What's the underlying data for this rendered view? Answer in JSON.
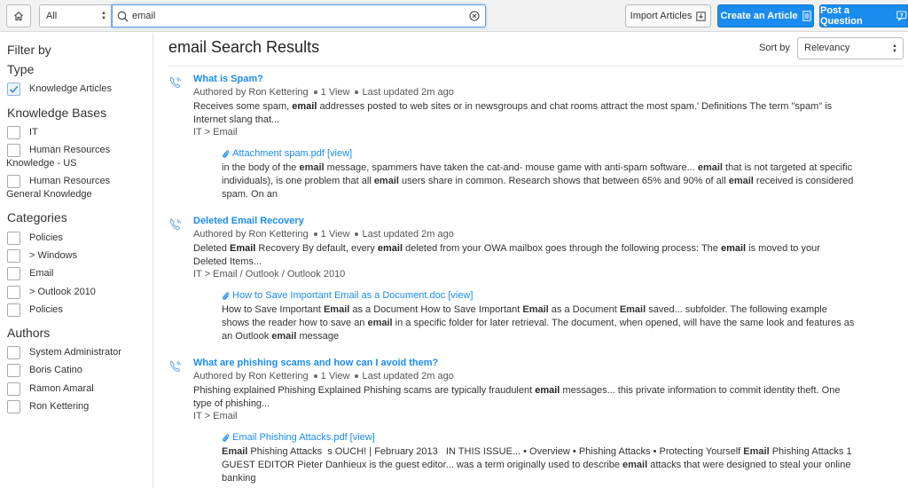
{
  "topbar": {
    "scope_value": "All",
    "search_value": "email",
    "import_label": "Import Articles",
    "create_label": "Create an Article",
    "post_label": "Post a Question"
  },
  "sidebar": {
    "filter_title": "Filter by",
    "type_title": "Type",
    "type_items": [
      {
        "label": "Knowledge Articles",
        "checked": true
      }
    ],
    "kb_title": "Knowledge Bases",
    "kb_items": [
      {
        "label": "IT"
      },
      {
        "label": "Human Resources",
        "label2": "Knowledge - US"
      },
      {
        "label": "Human Resources",
        "label2": "General Knowledge"
      }
    ],
    "categories_title": "Categories",
    "categories": [
      "Policies",
      "> Windows",
      "Email",
      "> Outlook 2010",
      "Policies"
    ],
    "authors_title": "Authors",
    "authors": [
      "System Administrator",
      "Boris Catino",
      "Ramon Amaral",
      "Ron Kettering"
    ]
  },
  "main": {
    "results_title": "email Search Results",
    "sort_label": "Sort by",
    "sort_value": "Relevancy",
    "results": [
      {
        "title": "What is Spam?",
        "author": "Authored by Ron Kettering",
        "views": "1 View",
        "updated": "Last updated 2m ago",
        "snippet_html": "Receives some spam, <b>email</b> addresses posted to web sites or in newsgroups and chat rooms attract the most spam.' Definitions The term \"spam\" is Internet slang that...",
        "path": "IT > Email",
        "attachment_title": "Attachment spam.pdf [view]",
        "attachment_snippet_html": "in the body of the <b>email</b> message, spammers have taken the cat-and- mouse game with anti-spam software... <b>email</b> that is not targeted at specific individuals), is one problem that all <b>email</b> users share in common. Research shows that between 65% and 90% of all <b>email</b> received is considered spam. On an"
      },
      {
        "title": "Deleted Email Recovery",
        "author": "Authored by Ron Kettering",
        "views": "1 View",
        "updated": "Last updated 2m ago",
        "snippet_html": "Deleted <b>Email</b> Recovery By default, every <b>email</b> deleted from your OWA mailbox goes through the following process: The <b>email</b> is moved to your Deleted Items...",
        "path": "IT > Email / Outlook / Outlook 2010",
        "attachment_title": "How to Save Important Email as a Document.doc [view]",
        "attachment_snippet_html": "How to Save Important <b>Email</b> as a Document How to Save Important <b>Email</b> as a Document <b>Email</b> saved... subfolder. The following example shows the reader how to save an <b>email</b> in a specific folder for later retrieval. The document, when opened, will have the same look and features as an Outlook <b>email</b> message"
      },
      {
        "title": "What are phishing scams and how can I avoid them?",
        "author": "Authored by Ron Kettering",
        "views": "1 View",
        "updated": "Last updated 2m ago",
        "snippet_html": "Phishing explained Phishing Explained Phishing scams are typically fraudulent <b>email</b> messages... this private information to commit identity theft. One type of phishing...",
        "path": "IT > Email",
        "attachment_title": "Email Phishing Attacks.pdf [view]",
        "attachment_snippet_html": "<b>Email</b> Phishing Attacks &nbsp;s OUCH! | February 2013 &nbsp;&nbsp;IN THIS ISSUE... • Overview • Phishing Attacks • Protecting Yourself <b>Email</b> Phishing Attacks 1 GUEST EDITOR Pieter Danhieux is the guest editor... was a term originally used to describe <b>email</b> attacks that were designed to steal your online banking"
      }
    ]
  }
}
